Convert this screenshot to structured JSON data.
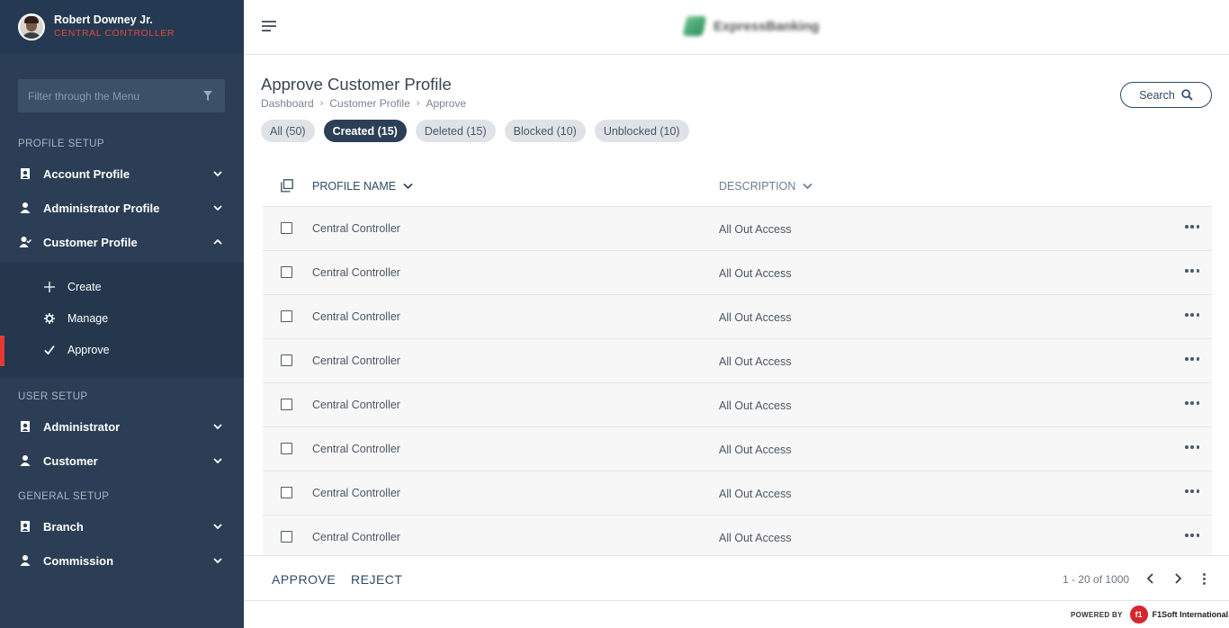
{
  "user": {
    "name": "Robert Downey Jr.",
    "role": "CENTRAL CONTROLLER"
  },
  "filter": {
    "placeholder": "Filter through the Menu"
  },
  "sidebar": {
    "sections": [
      {
        "title": "PROFILE SETUP"
      },
      {
        "title": "USER SETUP"
      },
      {
        "title": "GENERAL SETUP"
      }
    ],
    "items": [
      {
        "label": "Account Profile",
        "icon": "user-lock-icon",
        "expanded": false
      },
      {
        "label": "Administrator Profile",
        "icon": "user-icon",
        "expanded": false
      },
      {
        "label": "Customer Profile",
        "icon": "user-check-icon",
        "expanded": true
      },
      {
        "label": "Administrator",
        "icon": "user-lock-icon",
        "expanded": false
      },
      {
        "label": "Customer",
        "icon": "user-icon",
        "expanded": false
      },
      {
        "label": "Branch",
        "icon": "user-lock-icon",
        "expanded": false
      },
      {
        "label": "Commission",
        "icon": "user-icon",
        "expanded": false
      }
    ],
    "sub_items": [
      {
        "label": "Create",
        "icon": "plus-icon"
      },
      {
        "label": "Manage",
        "icon": "gear-icon"
      },
      {
        "label": "Approve",
        "icon": "check-icon",
        "active": true
      }
    ],
    "active_color": "#e53935"
  },
  "header": {
    "logo_name": "ExpressBanking"
  },
  "page": {
    "title": "Approve Customer Profile",
    "breadcrumb": [
      "Dashboard",
      "Customer Profile",
      "Approve"
    ],
    "search_label": "Search"
  },
  "filters": [
    {
      "label": "All (50)",
      "active": false
    },
    {
      "label": "Created (15)",
      "active": true
    },
    {
      "label": "Deleted (15)",
      "active": false
    },
    {
      "label": "Blocked (10)",
      "active": false
    },
    {
      "label": "Unblocked (10)",
      "active": false
    }
  ],
  "table": {
    "columns": [
      "PROFILE NAME",
      "DESCRIPTION"
    ],
    "rows": [
      {
        "name": "Central Controller",
        "description": "All Out Access"
      },
      {
        "name": "Central Controller",
        "description": "All Out Access"
      },
      {
        "name": "Central Controller",
        "description": "All Out Access"
      },
      {
        "name": "Central Controller",
        "description": "All Out Access"
      },
      {
        "name": "Central Controller",
        "description": "All Out Access"
      },
      {
        "name": "Central Controller",
        "description": "All Out Access"
      },
      {
        "name": "Central Controller",
        "description": "All Out Access"
      },
      {
        "name": "Central Controller",
        "description": "All Out Access"
      }
    ]
  },
  "footer": {
    "approve_label": "APPROVE",
    "reject_label": "REJECT",
    "pagination": "1 - 20 of 1000"
  },
  "powered_by": {
    "label": "POWERED BY",
    "company": "F1Soft International"
  },
  "colors": {
    "sidebar": "#2b3e55",
    "accent": "#2c3f56",
    "role": "#e0463f"
  }
}
